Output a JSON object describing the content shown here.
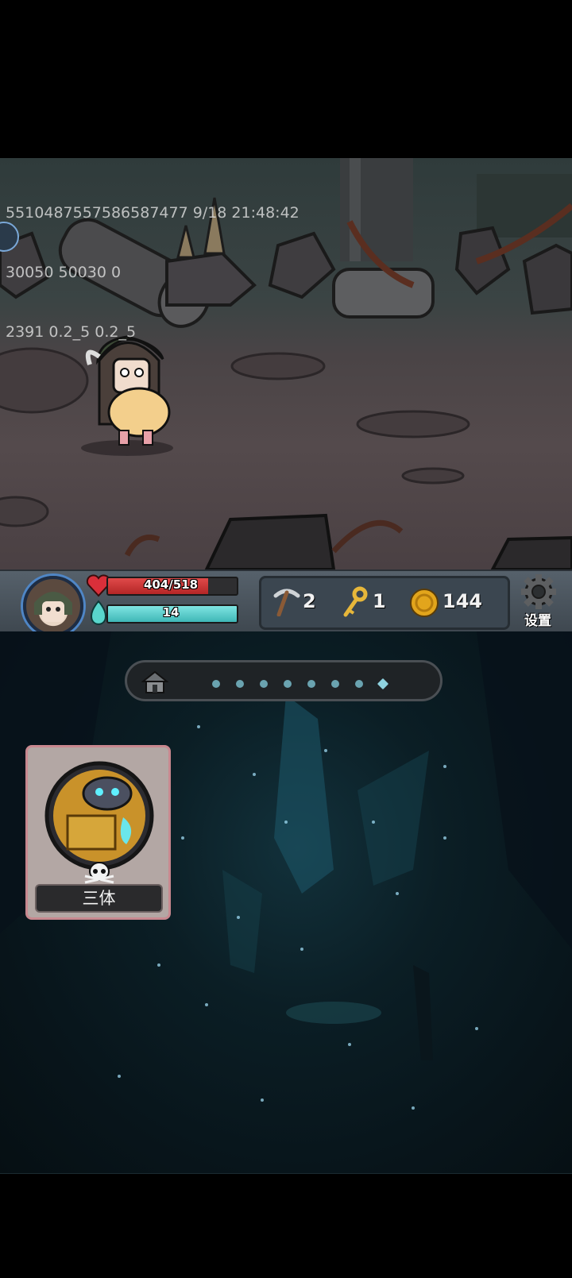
{
  "debug_lines": [
    "5510487557586587477 9/18 21:48:42",
    "30050 50030 0",
    "2391 0.2_5 0.2_5"
  ],
  "player": {
    "hp_text": "404/518",
    "hp_fraction": 0.78,
    "mp_text": "14",
    "mp_fraction": 1.0
  },
  "resources": {
    "pickaxe": "2",
    "key": "1",
    "coins": "144"
  },
  "settings_label": "设置",
  "progress": {
    "icon": "house-icon",
    "total_dots": 7,
    "current_marker": "diamond"
  },
  "enemy": {
    "name": "三体",
    "icon": "skull-icon"
  },
  "colors": {
    "hp": "#c62f2f",
    "mp": "#4cc3c2",
    "card_border": "#c8888f"
  }
}
